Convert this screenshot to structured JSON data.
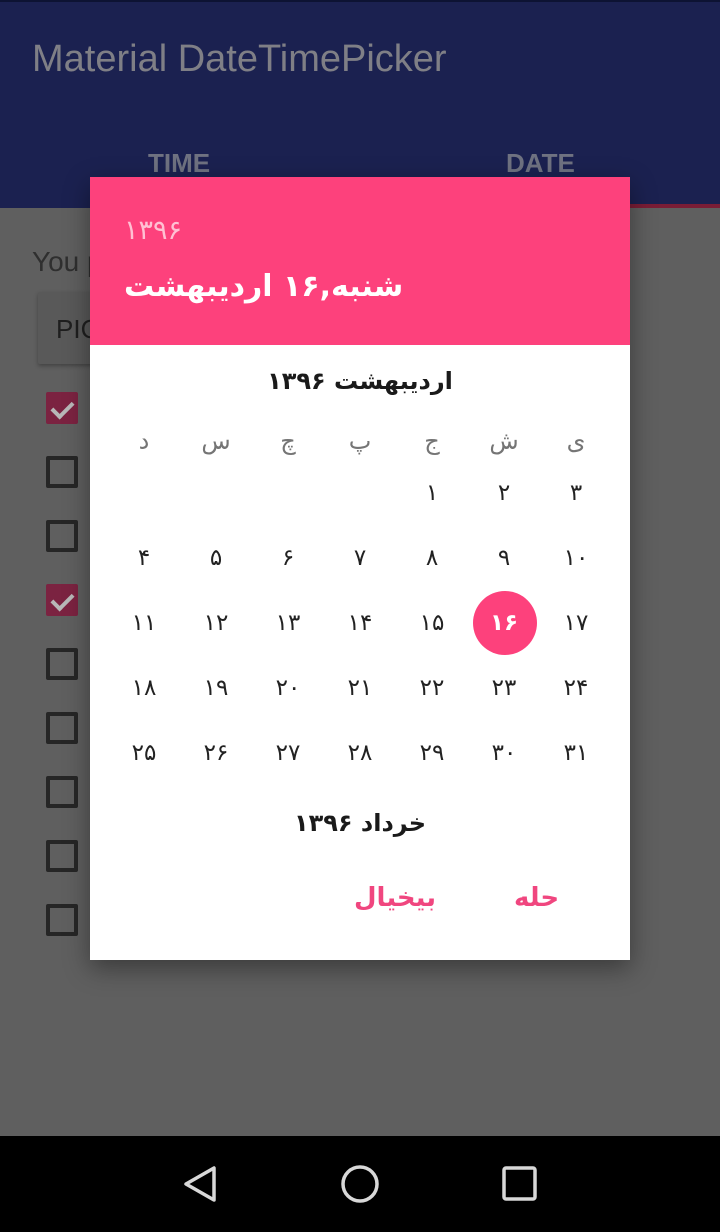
{
  "app": {
    "title": "Material DateTimePicker",
    "tabs": [
      "TIME",
      "DATE"
    ],
    "behind_text": "You p",
    "behind_button": "PIC",
    "checkboxes": [
      true,
      false,
      false,
      true,
      false,
      false,
      false,
      false,
      false
    ]
  },
  "dialog": {
    "header_year": "۱۳۹۶",
    "header_date": "شنبه,۱۶ اردیبهشت",
    "month_title": "اردیبهشت ۱۳۹۶",
    "next_month_title": "خرداد ۱۳۹۶",
    "weekdays": [
      "ی",
      "ش",
      "ج",
      "پ",
      "چ",
      "س",
      "د"
    ],
    "weeks": [
      [
        "۳",
        "۲",
        "۱",
        "",
        "",
        "",
        ""
      ],
      [
        "۱۰",
        "۹",
        "۸",
        "۷",
        "۶",
        "۵",
        "۴"
      ],
      [
        "۱۷",
        "۱۶",
        "۱۵",
        "۱۴",
        "۱۳",
        "۱۲",
        "۱۱"
      ],
      [
        "۲۴",
        "۲۳",
        "۲۲",
        "۲۱",
        "۲۰",
        "۱۹",
        "۱۸"
      ],
      [
        "۳۱",
        "۳۰",
        "۲۹",
        "۲۸",
        "۲۷",
        "۲۶",
        "۲۵"
      ]
    ],
    "selected_day": "۱۶",
    "cancel_label": "بیخیال",
    "ok_label": "حله",
    "accent_color": "#fd417c"
  },
  "navbar": {
    "icons": [
      "back-icon",
      "home-icon",
      "recents-icon"
    ]
  }
}
